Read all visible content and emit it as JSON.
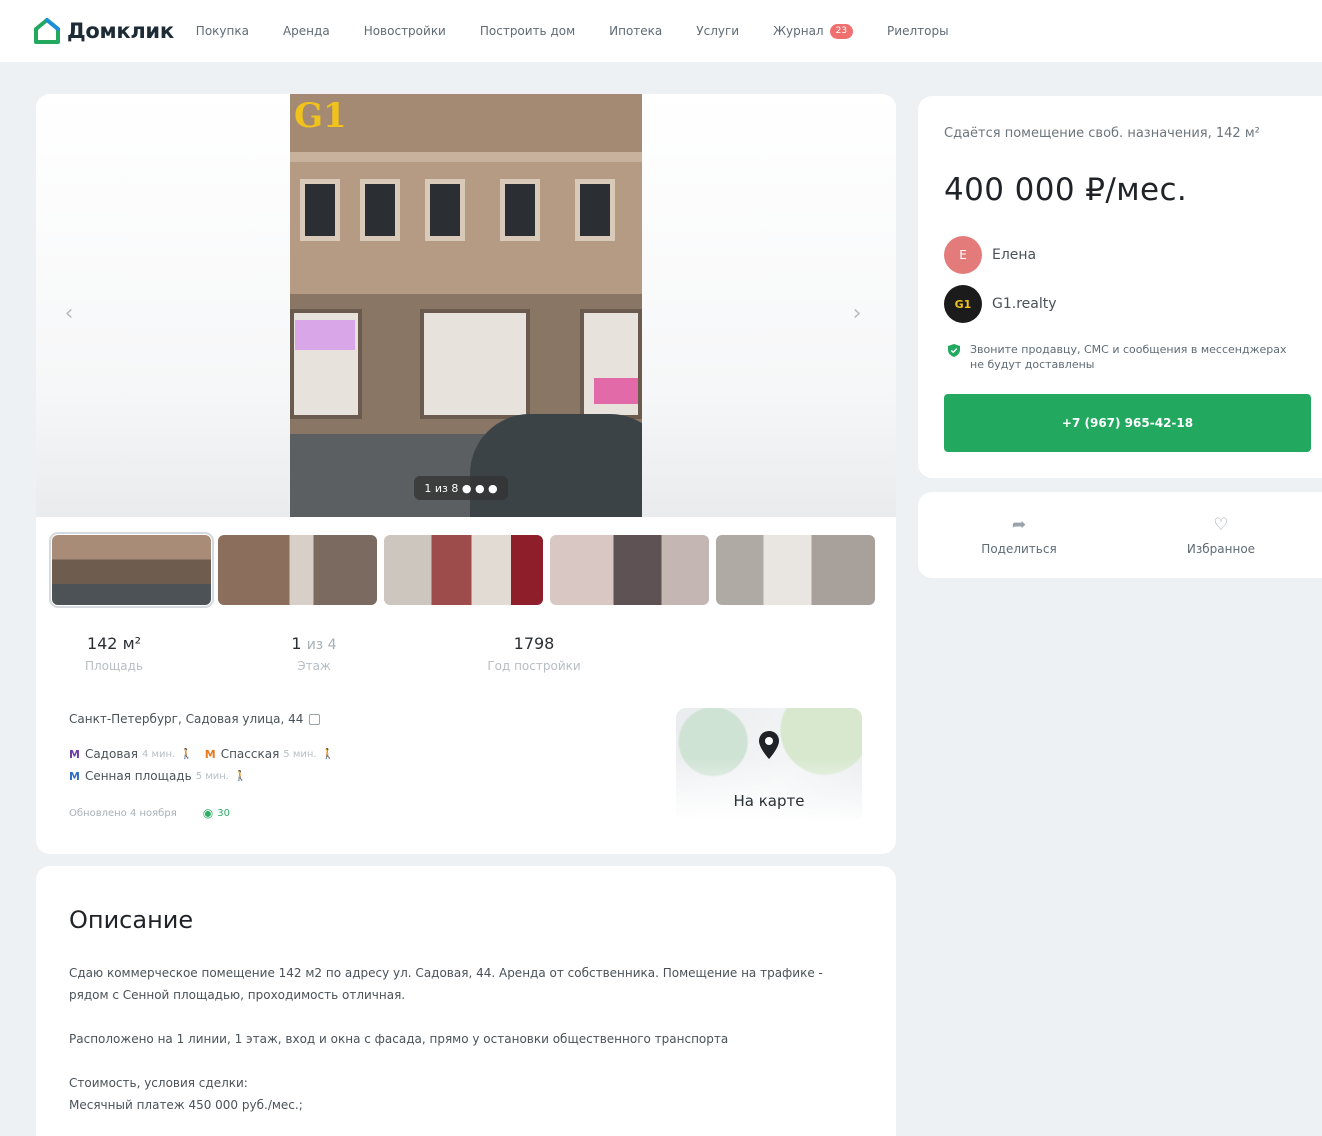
{
  "brand": {
    "name": "Домклик",
    "accent": "#22a85f"
  },
  "nav": [
    {
      "label": "Покупка"
    },
    {
      "label": "Аренда"
    },
    {
      "label": "Новостройки"
    },
    {
      "label": "Построить дом"
    },
    {
      "label": "Ипотека"
    },
    {
      "label": "Услуги"
    },
    {
      "label": "Журнал",
      "badge": "23"
    },
    {
      "label": "Риелторы"
    }
  ],
  "gallery": {
    "counter": "1 из 8 ● ● ●",
    "sign_text": "G1",
    "prev_icon": "chevron-left-icon",
    "next_icon": "chevron-right-icon"
  },
  "stats": [
    {
      "value": "142 м²",
      "muted": "",
      "label": "Площадь"
    },
    {
      "value": "1",
      "muted": "из 4",
      "label": "Этаж"
    },
    {
      "value": "1798",
      "muted": "",
      "label": "Год постройки"
    }
  ],
  "address": "Санкт-Петербург, Садовая улица, 44",
  "metro": [
    {
      "name": "Садовая",
      "time": "4 мин.",
      "color": "purple"
    },
    {
      "name": "Спасская",
      "time": "5 мин.",
      "color": "orange"
    },
    {
      "name": "Сенная площадь",
      "time": "5 мин.",
      "color": "blue"
    }
  ],
  "updated": "Обновлено 4 ноября",
  "views": "30",
  "map": {
    "label": "На карте"
  },
  "description": {
    "title": "Описание",
    "paragraphs": [
      "Сдаю коммерческое помещение 142 м2 по адресу ул. Садовая, 44. Аренда от собственника. Помещение на трафике - рядом с Сенной площадью, проходимость отличная.",
      "Расположено на 1 линии, 1 этаж, вход и окна с фасада, прямо у остановки общественного транспорта",
      "Стоимость, условия сделки:",
      "Месячный платеж 450 000 руб./мес.;"
    ]
  },
  "offer": {
    "title": "Сдаётся помещение своб. назначения, 142 м²",
    "price": "400 000 ₽/мес.",
    "agent_name": "Елена",
    "agent_initial": "Е",
    "company_name": "G1.realty",
    "company_logo_text": "G1",
    "notice": "Звоните продавцу, СМС и сообщения в мессенджерах не будут доставлены",
    "phone": "+7 (967) 965-42-18"
  },
  "actions": {
    "share": "Поделиться",
    "favorite": "Избранное"
  }
}
